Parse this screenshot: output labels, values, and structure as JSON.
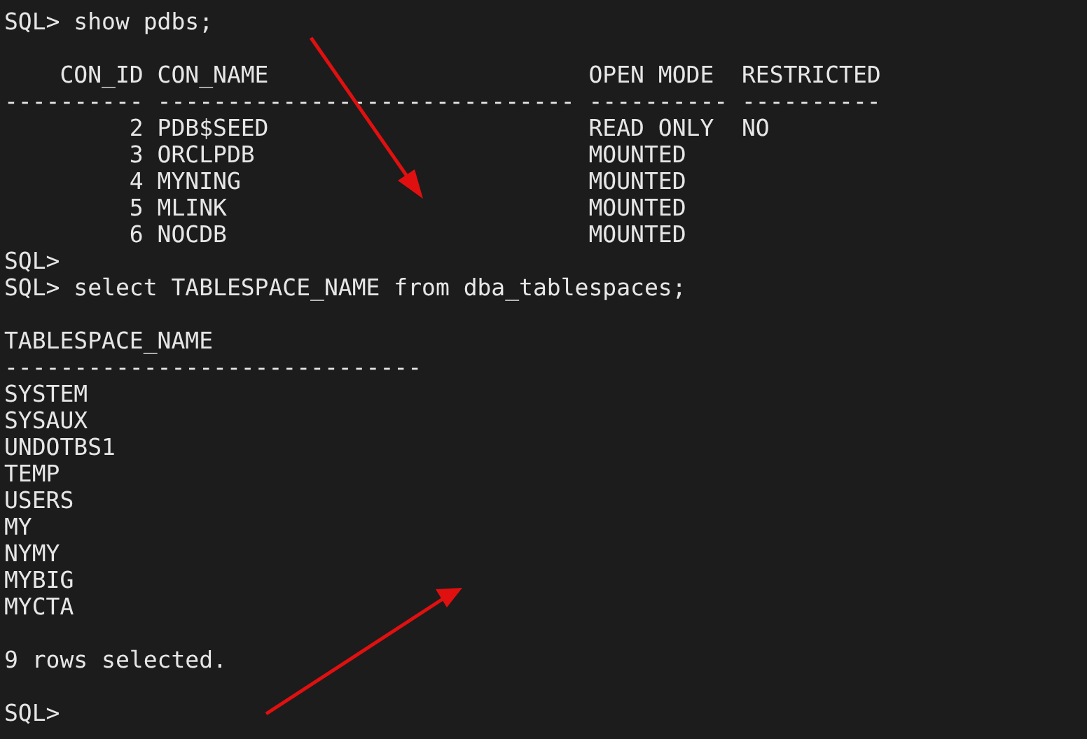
{
  "terminal": {
    "lines": [
      {
        "kind": "text",
        "text": "SQL> show pdbs;"
      },
      {
        "kind": "blank"
      },
      {
        "kind": "text",
        "text": "    CON_ID CON_NAME                       OPEN MODE  RESTRICTED"
      },
      {
        "kind": "text",
        "text": "---------- ------------------------------ ---------- ----------"
      },
      {
        "kind": "text",
        "text": "         2 PDB$SEED                       READ ONLY  NO"
      },
      {
        "kind": "text",
        "text": "         3 ORCLPDB                        MOUNTED"
      },
      {
        "kind": "text",
        "text": "         4 MYNING                         MOUNTED"
      },
      {
        "kind": "text",
        "text": "         5 MLINK                          MOUNTED"
      },
      {
        "kind": "text",
        "text": "         6 NOCDB                          MOUNTED"
      },
      {
        "kind": "text",
        "text": "SQL>"
      },
      {
        "kind": "text",
        "text": "SQL> select TABLESPACE_NAME from dba_tablespaces;"
      },
      {
        "kind": "blank"
      },
      {
        "kind": "text",
        "text": "TABLESPACE_NAME"
      },
      {
        "kind": "text",
        "text": "------------------------------"
      },
      {
        "kind": "text",
        "text": "SYSTEM"
      },
      {
        "kind": "text",
        "text": "SYSAUX"
      },
      {
        "kind": "text",
        "text": "UNDOTBS1"
      },
      {
        "kind": "text",
        "text": "TEMP"
      },
      {
        "kind": "text",
        "text": "USERS"
      },
      {
        "kind": "text",
        "text": "MY"
      },
      {
        "kind": "text",
        "text": "NYMY"
      },
      {
        "kind": "text",
        "text": "MYBIG"
      },
      {
        "kind": "text",
        "text": "MYCTA"
      },
      {
        "kind": "blank"
      },
      {
        "kind": "text",
        "text": "9 rows selected."
      },
      {
        "kind": "blank"
      },
      {
        "kind": "text",
        "text": "SQL>"
      }
    ]
  }
}
